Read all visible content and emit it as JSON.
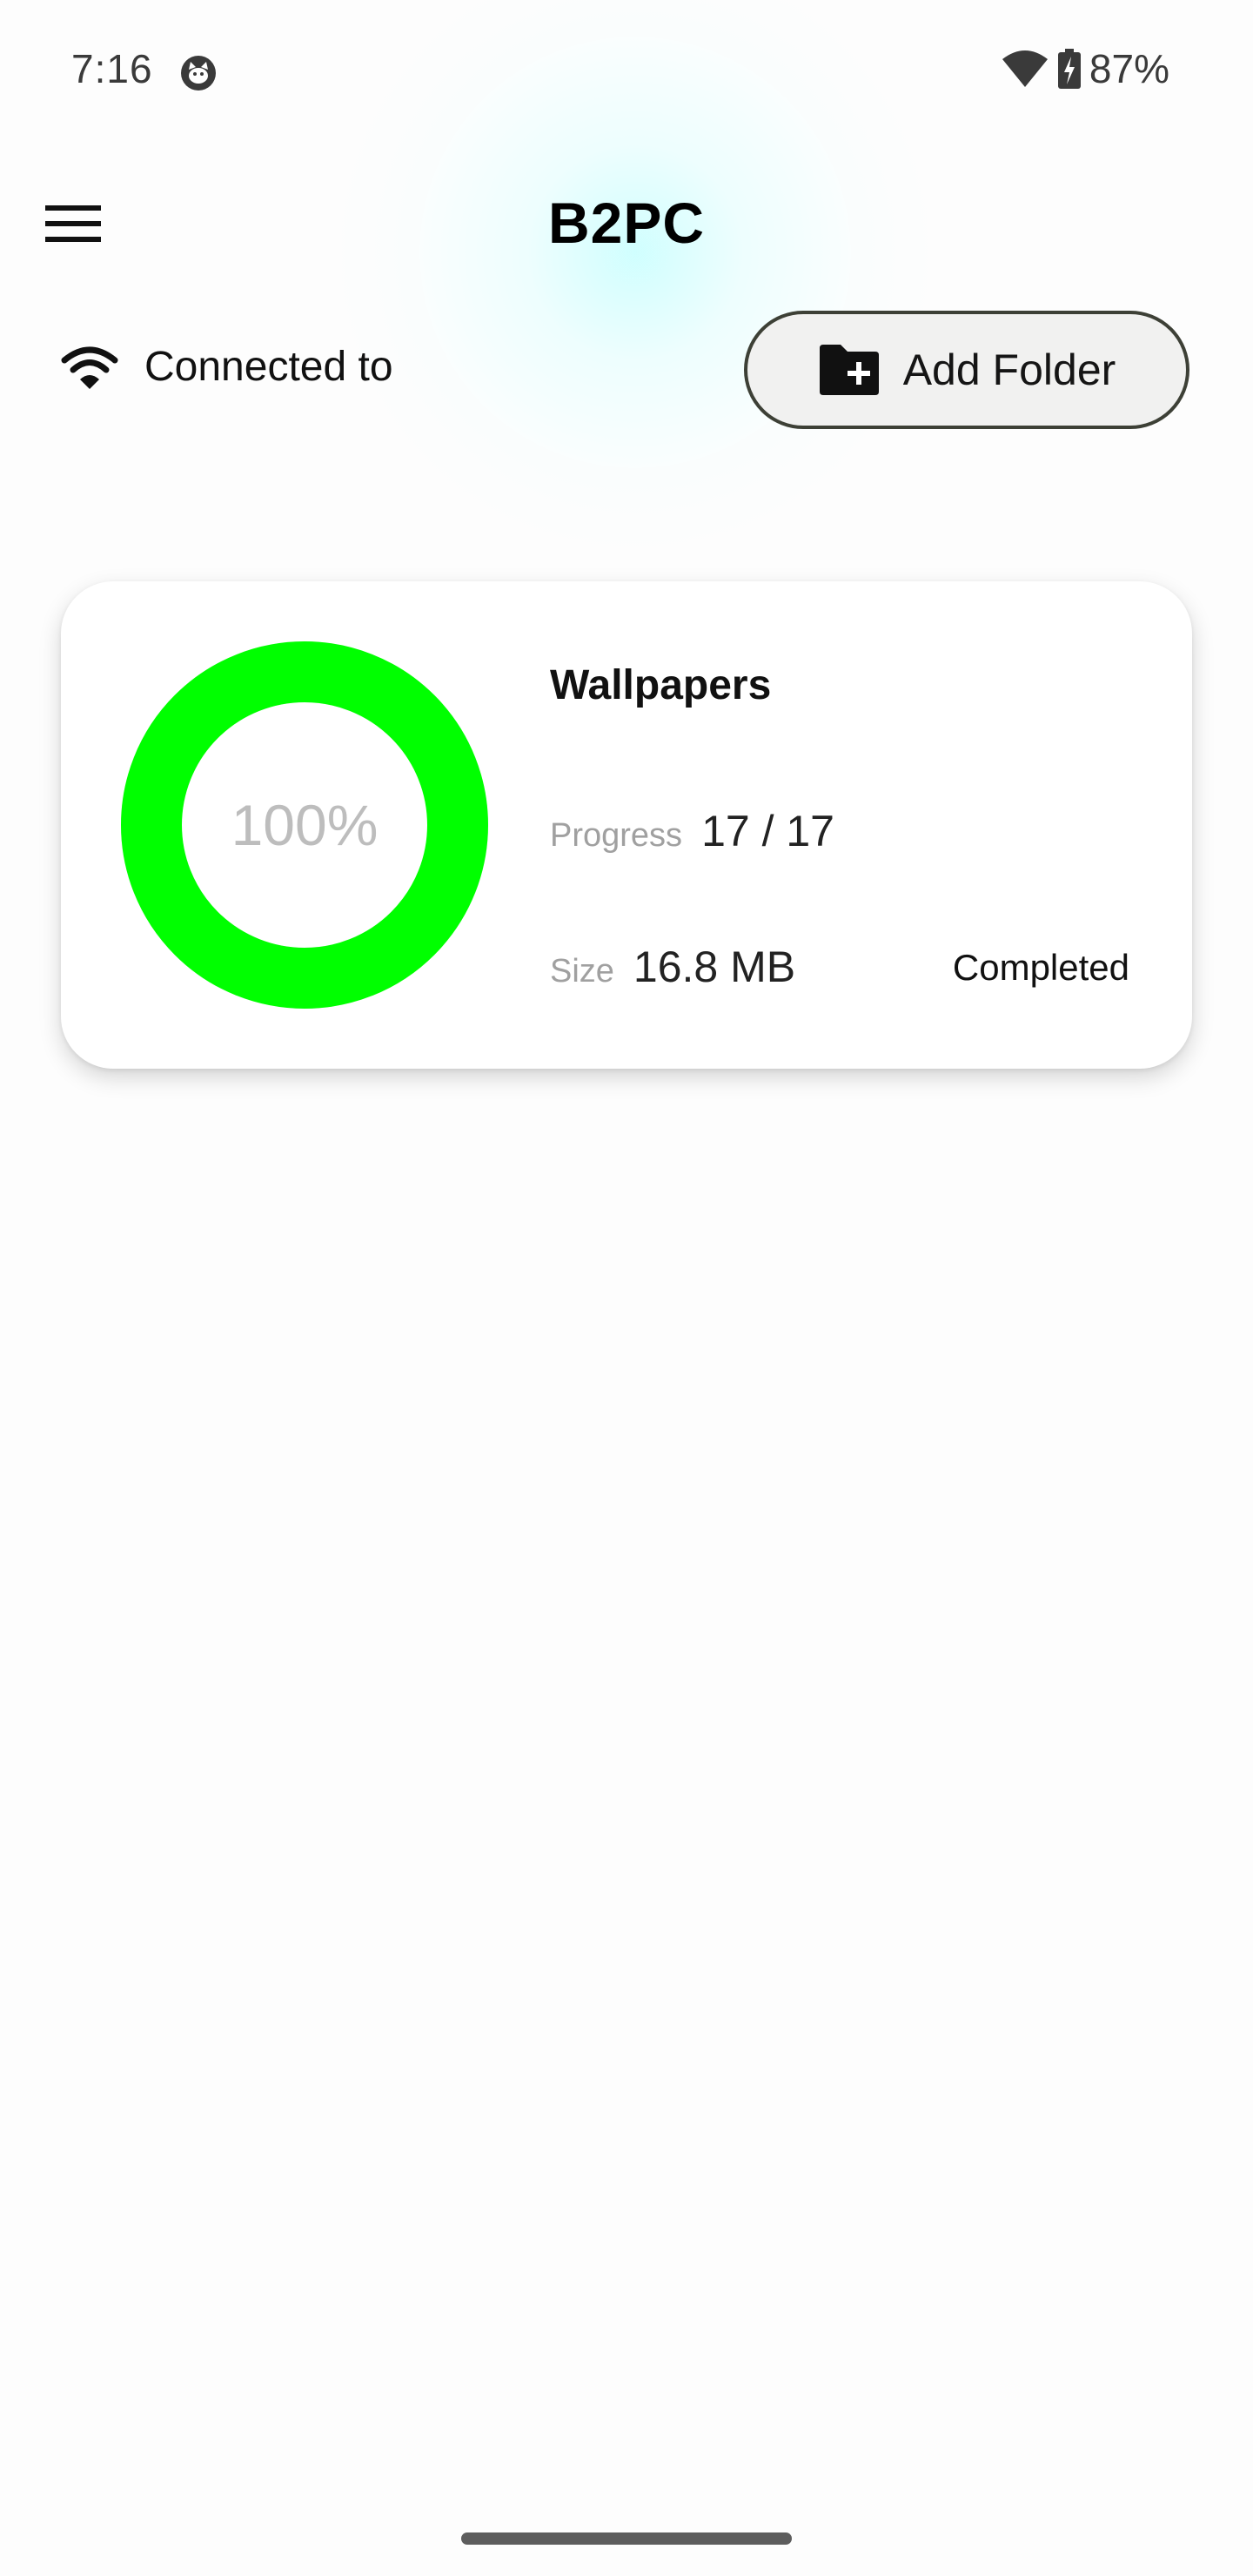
{
  "status_bar": {
    "time": "7:16",
    "battery": "87%",
    "icons": [
      "cat-face-icon",
      "wifi-icon",
      "battery-charging-icon"
    ]
  },
  "app_bar": {
    "title": "B2PC",
    "menu_icon": "hamburger-menu-icon"
  },
  "connection": {
    "label": "Connected to",
    "icon": "wifi-icon"
  },
  "actions": {
    "add_folder_label": "Add Folder",
    "add_folder_icon": "create-new-folder-icon"
  },
  "folders": [
    {
      "name": "Wallpapers",
      "progress_percent_label": "100%",
      "progress_fraction": 1.0,
      "progress_label": "Progress",
      "progress_value": "17 / 17",
      "size_label": "Size",
      "size_value": "16.8 MB",
      "status": "Completed"
    }
  ],
  "colors": {
    "progress_ring": "#00ff00",
    "progress_track": "#e6e6e6",
    "button_border": "#3d4036",
    "button_bg": "#f1f1f0",
    "glow": "#c8ffff"
  }
}
